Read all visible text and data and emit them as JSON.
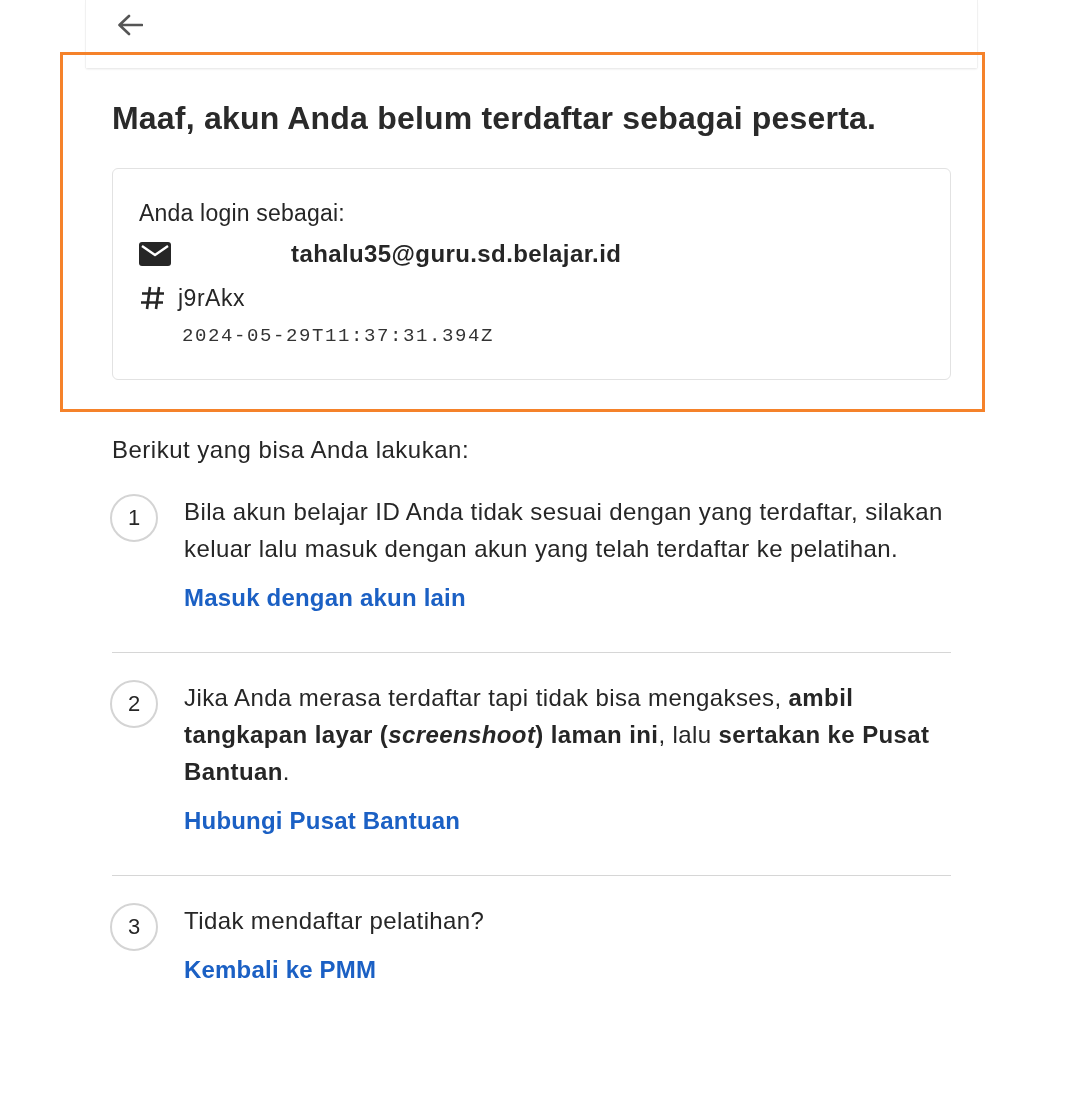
{
  "notice": {
    "highlighted": true,
    "title": "Maaf, akun Anda belum terdaftar sebagai peserta.",
    "account_card": {
      "label": "Anda login sebagai:",
      "email": "tahalu35@guru.sd.belajar.id",
      "user_id": "j9rAkx",
      "timestamp": "2024-05-29T11:37:31.394Z"
    }
  },
  "steps_intro": "Berikut yang bisa Anda lakukan:",
  "steps": [
    {
      "number": "1",
      "text": "Bila akun belajar ID Anda tidak sesuai dengan yang terdaftar, silakan keluar lalu masuk dengan akun yang telah terdaftar ke pelatihan.",
      "link": "Masuk dengan akun lain"
    },
    {
      "number": "2",
      "text": "Jika Anda merasa terdaftar tapi tidak bisa mengakses, **ambil tangkapan layar (*screenshoot*) laman ini**, lalu **sertakan ke Pusat Bantuan**.",
      "link": "Hubungi Pusat Bantuan"
    },
    {
      "number": "3",
      "text": "Tidak mendaftar pelatihan?",
      "link": "Kembali ke PMM"
    }
  ]
}
